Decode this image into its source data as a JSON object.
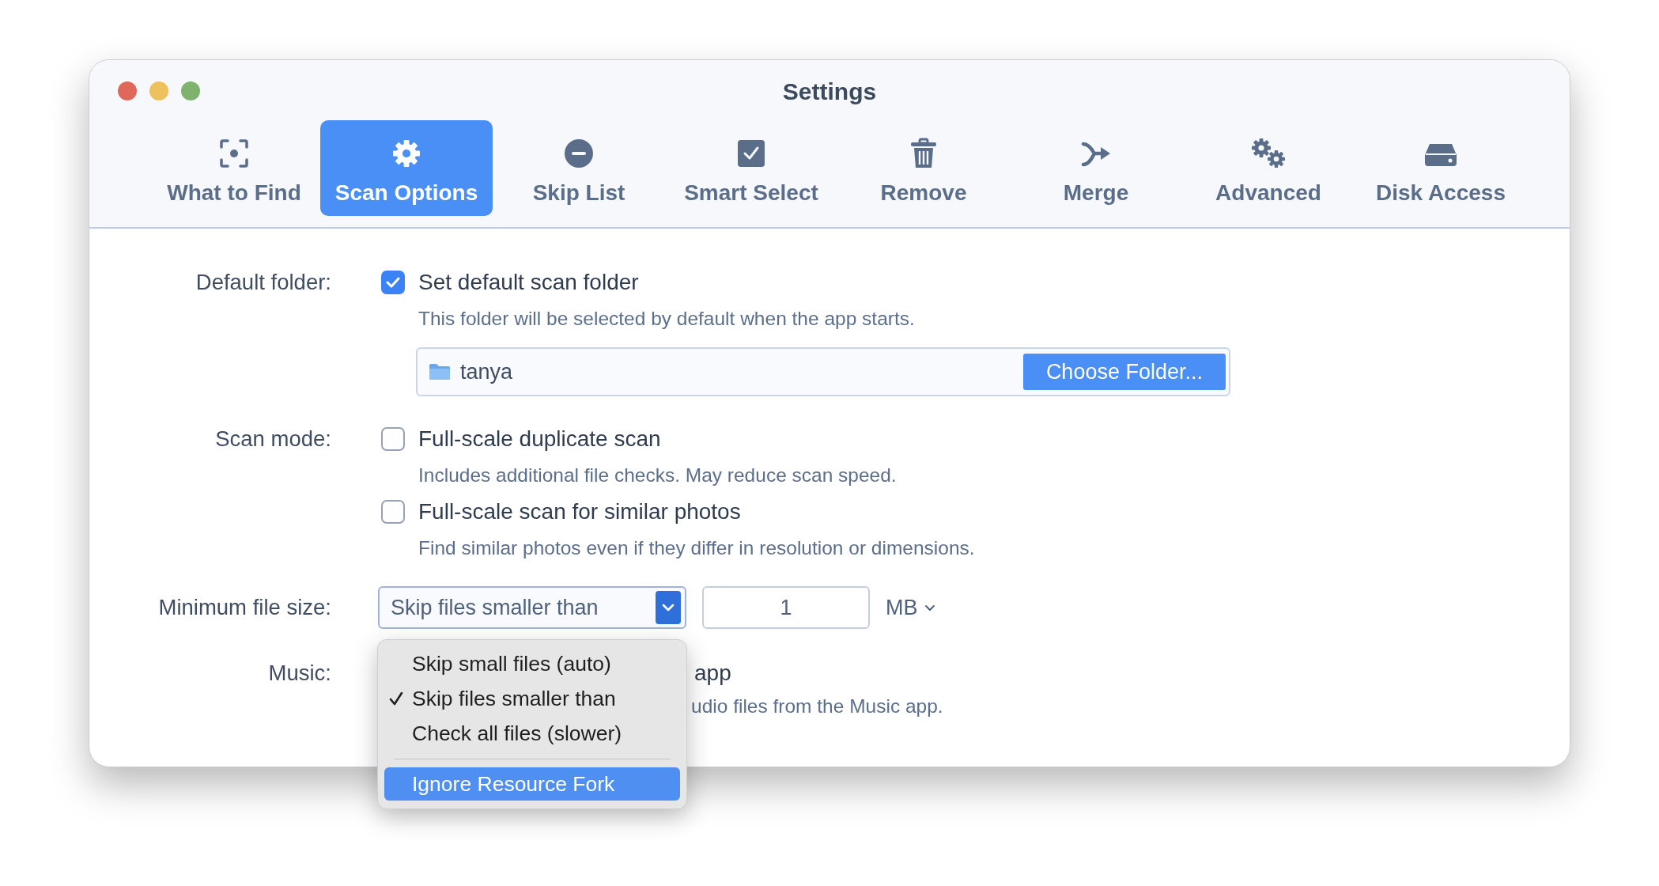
{
  "window": {
    "title": "Settings"
  },
  "tabs": [
    {
      "label": "What to Find",
      "selected": false
    },
    {
      "label": "Scan Options",
      "selected": true
    },
    {
      "label": "Skip List",
      "selected": false
    },
    {
      "label": "Smart Select",
      "selected": false
    },
    {
      "label": "Remove",
      "selected": false
    },
    {
      "label": "Merge",
      "selected": false
    },
    {
      "label": "Advanced",
      "selected": false
    },
    {
      "label": "Disk Access",
      "selected": false
    }
  ],
  "default_folder": {
    "label": "Default folder:",
    "checkbox": {
      "label": "Set default scan folder",
      "checked": true
    },
    "description": "This folder will be selected by default when the app starts.",
    "folder_field": {
      "value": "tanya"
    },
    "button": "Choose Folder..."
  },
  "scan_mode": {
    "label": "Scan mode:",
    "options": [
      {
        "label": "Full-scale duplicate scan",
        "checked": false,
        "description": "Includes additional file checks. May reduce scan speed."
      },
      {
        "label": "Full-scale scan for similar photos",
        "checked": false,
        "description": "Find similar photos even if they differ in resolution or dimensions."
      }
    ]
  },
  "minimum_file_size": {
    "label": "Minimum file size:",
    "select": {
      "value": "Skip files smaller than",
      "expanded": true
    },
    "size_value": "1",
    "unit": "MB",
    "menu": [
      {
        "label": "Skip small files (auto)",
        "selected": false
      },
      {
        "label": "Skip files smaller than",
        "selected": true
      },
      {
        "label": "Check all files (slower)",
        "selected": false
      }
    ],
    "menu_action": {
      "label": "Ignore Resource Fork",
      "highlighted": true
    }
  },
  "music": {
    "label": "Music:",
    "option_label": "app",
    "description": "udio files from the Music app."
  }
}
